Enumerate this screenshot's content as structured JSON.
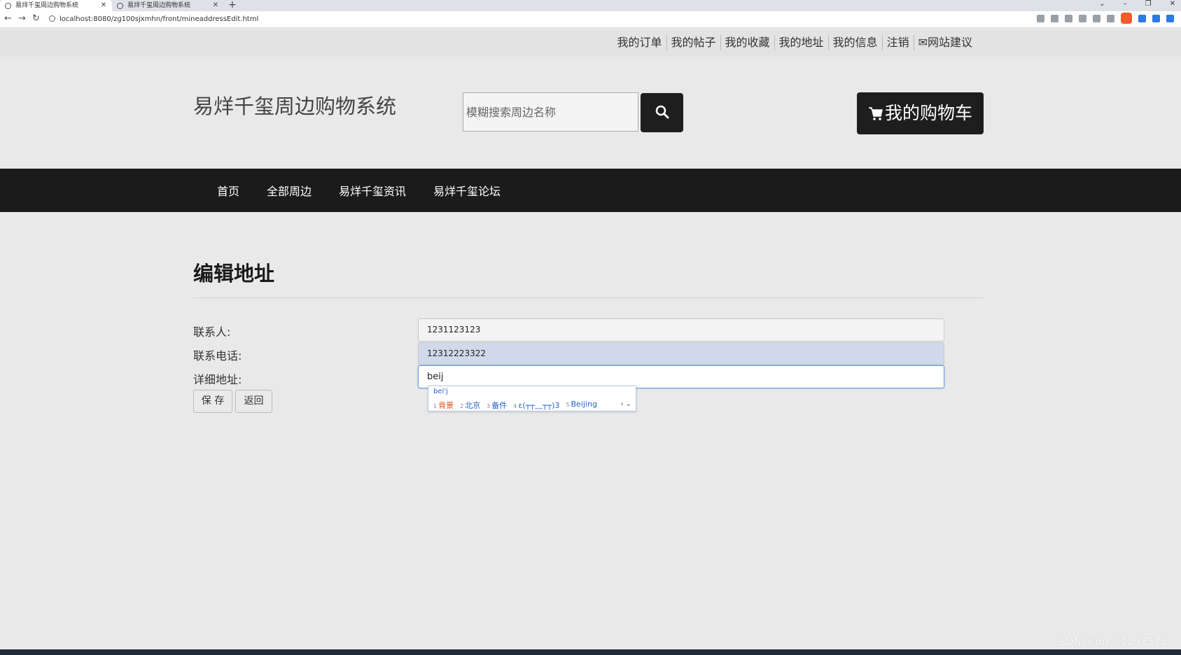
{
  "browser": {
    "tabs": [
      {
        "title": "易烊千玺周边购物系统",
        "active": true
      },
      {
        "title": "易烊千玺周边购物系统",
        "active": false
      }
    ],
    "url": "localhost:8080/zg100sjxmhn/front/mineaddressEdit.html"
  },
  "toplinks": [
    "我的订单",
    "我的帖子",
    "我的收藏",
    "我的地址",
    "我的信息",
    "注销",
    "✉网站建议"
  ],
  "header": {
    "site_title": "易烊千玺周边购物系统",
    "search_placeholder": "模糊搜索周边名称",
    "cart_label": "我的购物车"
  },
  "nav": [
    "首页",
    "全部周边",
    "易烊千玺资讯",
    "易烊千玺论坛"
  ],
  "form": {
    "heading": "编辑地址",
    "contact_label": "联系人:",
    "contact_value": "1231123123",
    "phone_label": "联系电话:",
    "phone_value": "12312223322",
    "address_label": "详细地址:",
    "address_value": "beij",
    "save_label": "保 存",
    "back_label": "返回"
  },
  "ime": {
    "pinyin": "bei'j",
    "candidates": [
      {
        "index": "1",
        "text": "背景"
      },
      {
        "index": "2",
        "text": "北京"
      },
      {
        "index": "3",
        "text": "备件"
      },
      {
        "index": "4",
        "text": "ε(┬┬﹏┬┬)3"
      },
      {
        "index": "5",
        "text": "Beijing"
      }
    ],
    "more": "› ⌄"
  },
  "watermark": "CSDN @qq_31293575",
  "colors": {
    "dark": "#1b1b1b",
    "page_bg": "#e9e9e9",
    "accent_blue": "#2563c9",
    "ime_first": "#e2531c"
  }
}
